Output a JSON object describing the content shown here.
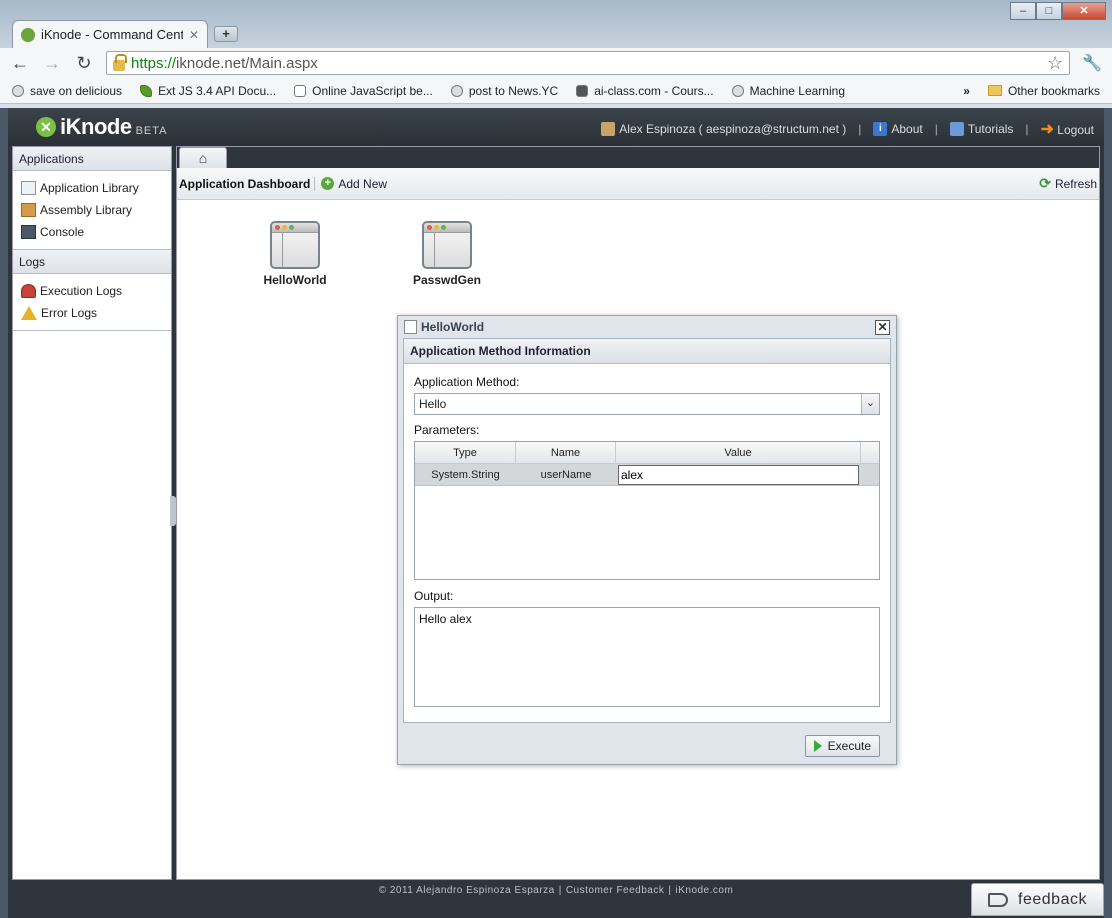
{
  "browser": {
    "tab_title": "iKnode - Command Center",
    "url_scheme": "https://",
    "url_rest": "iknode.net/Main.aspx",
    "bookmarks": [
      "save on delicious",
      "Ext JS 3.4 API Docu...",
      "Online JavaScript be...",
      "post to News.YC",
      "ai-class.com - Cours...",
      "Machine Learning"
    ],
    "other_bookmarks": "Other bookmarks"
  },
  "header": {
    "logo_text": "iKnode",
    "logo_beta": "BETA",
    "user": "Alex Espinoza ( aespinoza@structum.net )",
    "about": "About",
    "tutorials": "Tutorials",
    "logout": "Logout"
  },
  "sidebar": {
    "applications_title": "Applications",
    "applications": [
      "Application Library",
      "Assembly Library",
      "Console"
    ],
    "logs_title": "Logs",
    "logs": [
      "Execution Logs",
      "Error Logs"
    ]
  },
  "toolbar": {
    "title": "Application Dashboard",
    "add_new": "Add New",
    "refresh": "Refresh"
  },
  "apps": [
    "HelloWorld",
    "PasswdGen"
  ],
  "dialog": {
    "title": "HelloWorld",
    "section": "Application Method Information",
    "method_label": "Application Method:",
    "method_value": "Hello",
    "params_label": "Parameters:",
    "columns": [
      "Type",
      "Name",
      "Value"
    ],
    "row": {
      "type": "System.String",
      "name": "userName",
      "value": "alex"
    },
    "output_label": "Output:",
    "output_value": "Hello alex",
    "execute": "Execute"
  },
  "footer": {
    "copyright": "© 2011 Alejandro Espinoza Esparza",
    "customer_feedback": "Customer Feedback",
    "site": "iKnode.com",
    "feedback_button": "feedback"
  }
}
